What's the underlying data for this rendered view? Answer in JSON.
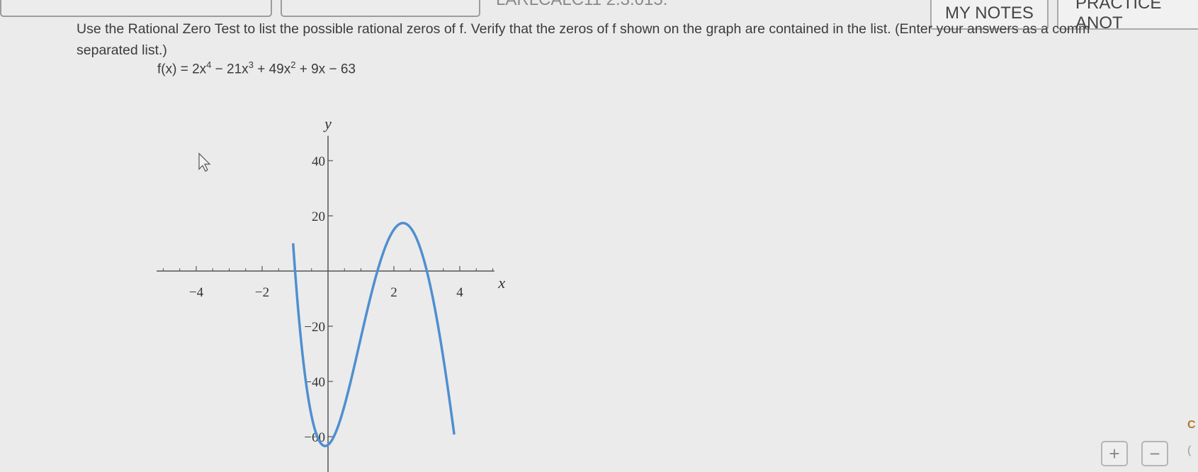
{
  "header": {
    "title_fragment": "LARLCALC11 2.3.015.",
    "my_notes_label": "MY NOTES",
    "practice_label": "PRACTICE ANOT"
  },
  "question": {
    "line1": "Use the Rational Zero Test to list the possible rational zeros of f. Verify that the zeros of f shown on the graph are contained in the list. (Enter your answers as a comm",
    "line2": "separated list.)"
  },
  "formula": {
    "lhs": "f(x) = 2x",
    "exp4": "4",
    "mid1": " − 21x",
    "exp3": "3",
    "mid2": " + 49x",
    "exp2": "2",
    "tail": " + 9x − 63"
  },
  "chart_data": {
    "type": "line",
    "function": "2x^4 - 21x^3 + 49x^2 + 9x - 63",
    "xlabel": "x",
    "ylabel": "y",
    "x_tick_labels": [
      "−4",
      "−2",
      "2",
      "4"
    ],
    "y_tick_labels": [
      "40",
      "20",
      "−20",
      "−40",
      "−60"
    ],
    "x_ticks": [
      -4,
      -2,
      2,
      4
    ],
    "y_ticks": [
      40,
      20,
      -20,
      -40,
      -60
    ],
    "xlim": [
      -5.2,
      5.2
    ],
    "ylim": [
      -72,
      52
    ],
    "plot_domain": [
      -1.06,
      3.83
    ],
    "series_color": "#4f8fd0"
  },
  "zoom": {
    "plus_label": "+",
    "minus_label": "−"
  },
  "edge_glyphs": {
    "top": "C",
    "bottom": "("
  }
}
